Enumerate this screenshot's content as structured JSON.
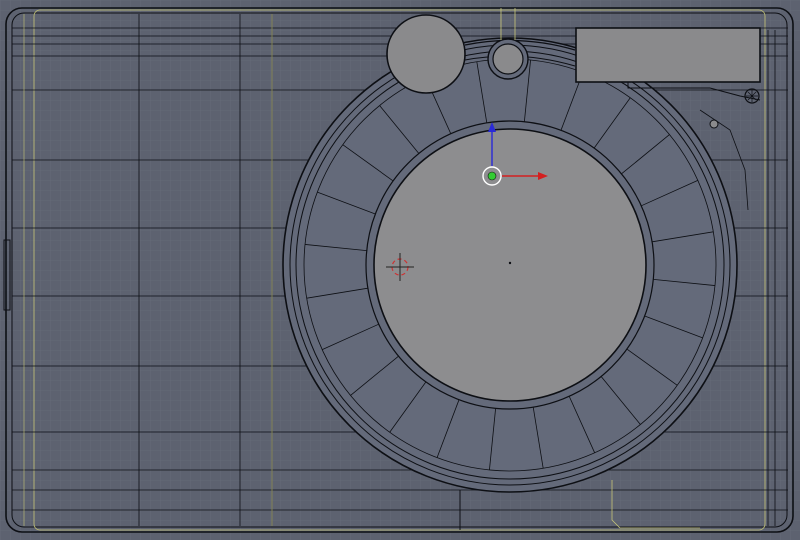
{
  "viewport": {
    "background": "#5d6270",
    "grid_color": "#6a6f7c",
    "wire_color": "#0d0f14",
    "selected_wire_color": "#c8c878",
    "face_fill": "#646a7a",
    "lens_fill": "#8d8d8f",
    "shutter_fill": "#8a8a8c"
  },
  "object": {
    "name": "camera-body",
    "lens_segments": 24
  },
  "gizmo": {
    "x_axis_color": "#d42020",
    "y_axis_color": "#2a2ad8",
    "origin_color": "#33cc33",
    "ring_color": "#ffffff"
  },
  "cursor_3d": {
    "primary_color": "#cc3333",
    "secondary_color": "#ffffff"
  }
}
